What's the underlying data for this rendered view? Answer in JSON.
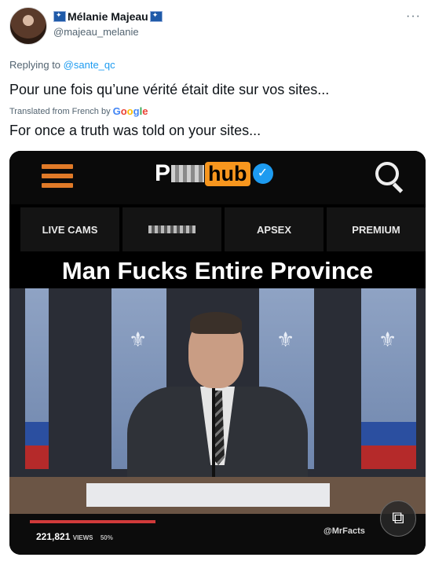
{
  "author": {
    "display_name": "Mélanie Majeau",
    "handle": "@majeau_melanie"
  },
  "reply": {
    "prefix": "Replying to",
    "target": "@sante_qc"
  },
  "tweet": {
    "text": "Pour une fois qu’une vérité était dite sur vos sites...",
    "translated_label": "Translated from French by",
    "translation_provider": "Google",
    "translation": "For once a truth was told on your sites..."
  },
  "media": {
    "logo_start": "P",
    "logo_hub": "hub",
    "nav": [
      "LIVE CAMS",
      "",
      "APSEX",
      "PREMIUM"
    ],
    "headline": "Man Fucks Entire Province",
    "views": "221,821",
    "views_label": "VIEWS",
    "percent": "50%",
    "watermark": "@MrFacts"
  },
  "menu": {
    "more": "···"
  },
  "colors": {
    "link": "#1d9bf0",
    "accent_orange": "#f7961e"
  }
}
